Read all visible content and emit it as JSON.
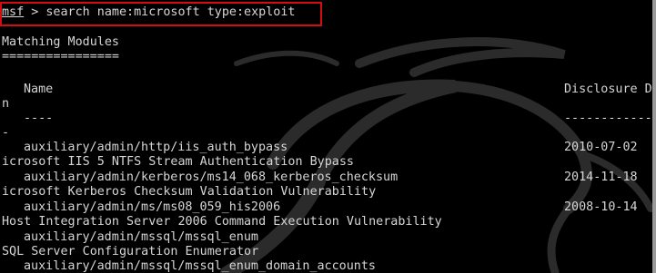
{
  "colors": {
    "background": "#000000",
    "text": "#d6d6d6",
    "highlight_border": "#d40d12"
  },
  "prompt": {
    "shell": "msf",
    "separator": " > ",
    "command": "search name:microsoft type:exploit"
  },
  "matching_modules_title": "Matching Modules",
  "title_underline": "================",
  "columns": {
    "name": "Name",
    "disclosure_date": "Disclosure D",
    "wrap_char": "n"
  },
  "dashes": {
    "name": "----",
    "date": "------------",
    "wrap_char": "-"
  },
  "modules": [
    {
      "name": "auxiliary/admin/http/iis_auth_bypass",
      "date": "2010-07-02",
      "description": "icrosoft IIS 5 NTFS Stream Authentication Bypass"
    },
    {
      "name": "auxiliary/admin/kerberos/ms14_068_kerberos_checksum",
      "date": "2014-11-18",
      "description": "icrosoft Kerberos Checksum Validation Vulnerability"
    },
    {
      "name": "auxiliary/admin/ms/ms08_059_his2006",
      "date": "2008-10-14",
      "description": "Host Integration Server 2006 Command Execution Vulnerability"
    },
    {
      "name": "auxiliary/admin/mssql/mssql_enum",
      "date": "",
      "description": "SQL Server Configuration Enumerator"
    },
    {
      "name": "auxiliary/admin/mssql/mssql_enum_domain_accounts",
      "date": "",
      "description": ""
    }
  ]
}
